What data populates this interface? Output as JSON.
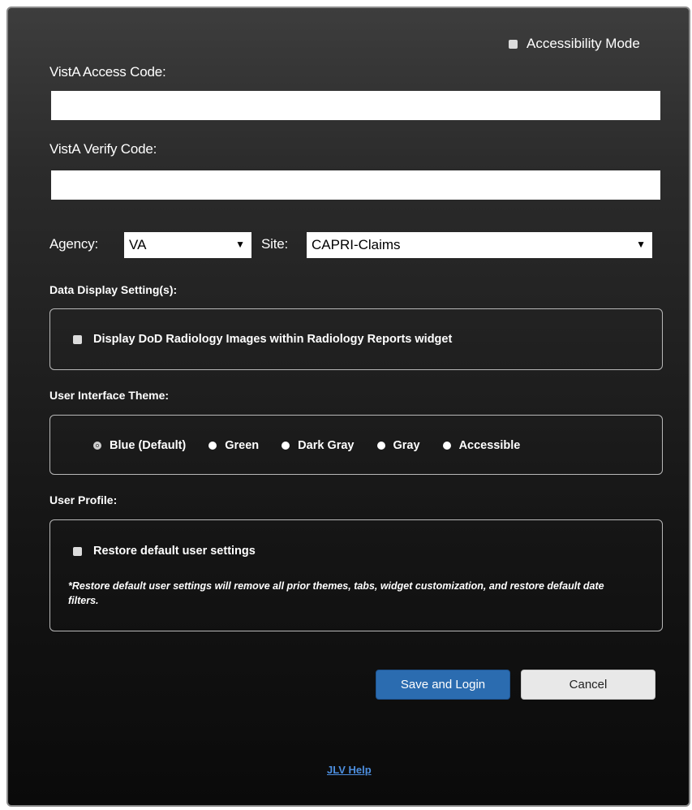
{
  "accessibility_mode": {
    "label": "Accessibility Mode",
    "checked": false
  },
  "access_code": {
    "label": "VistA Access Code:",
    "value": ""
  },
  "verify_code": {
    "label": "VistA Verify Code:",
    "value": ""
  },
  "agency": {
    "label": "Agency:",
    "selected": "VA"
  },
  "site": {
    "label": "Site:",
    "selected": "CAPRI-Claims"
  },
  "data_display": {
    "heading": "Data Display Setting(s):",
    "option_label": "Display DoD Radiology Images within Radiology Reports widget",
    "checked": false
  },
  "theme": {
    "heading": "User Interface Theme:",
    "options": [
      "Blue (Default)",
      "Green",
      "Dark Gray",
      "Gray",
      "Accessible"
    ],
    "selected": "Blue (Default)"
  },
  "user_profile": {
    "heading": "User Profile:",
    "restore_label": "Restore default user settings",
    "checked": false,
    "note": "*Restore default user settings will remove all prior themes, tabs, widget customization, and restore default date filters."
  },
  "buttons": {
    "save_login": "Save and Login",
    "cancel": "Cancel"
  },
  "help_link": "JLV Help",
  "colors": {
    "primary_button": "#2b6cb0",
    "link": "#4d8fe0"
  }
}
